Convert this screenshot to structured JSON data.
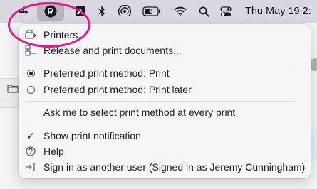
{
  "menubar": {
    "clock": "Thu May 19  2:",
    "icons": [
      "app-arrows-icon",
      "printer-app-icon",
      "screenshot-app-icon",
      "bluetooth-icon",
      "airdrop-icon",
      "battery-charging-icon",
      "wifi-icon",
      "search-icon",
      "control-center-icon"
    ]
  },
  "menu": {
    "items": [
      {
        "label": "Printers...",
        "icon": "printer-queue-icon"
      },
      {
        "label": "Release and print documents...",
        "icon": "release-documents-icon"
      },
      {
        "label": "Preferred print method: Print",
        "icon": "radio-selected",
        "selected": true
      },
      {
        "label": "Preferred print method: Print later",
        "icon": "radio-unselected",
        "selected": false
      },
      {
        "label": "Ask me to select print method at every print"
      },
      {
        "label": "Show print notification",
        "icon": "checkmark-icon",
        "checked": true
      },
      {
        "label": "Help",
        "icon": "help-icon"
      },
      {
        "label": "Sign in as another user (Signed in as Jeremy Cunningham)",
        "icon": "sign-in-icon"
      }
    ]
  },
  "highlight_color": "#e3198b"
}
